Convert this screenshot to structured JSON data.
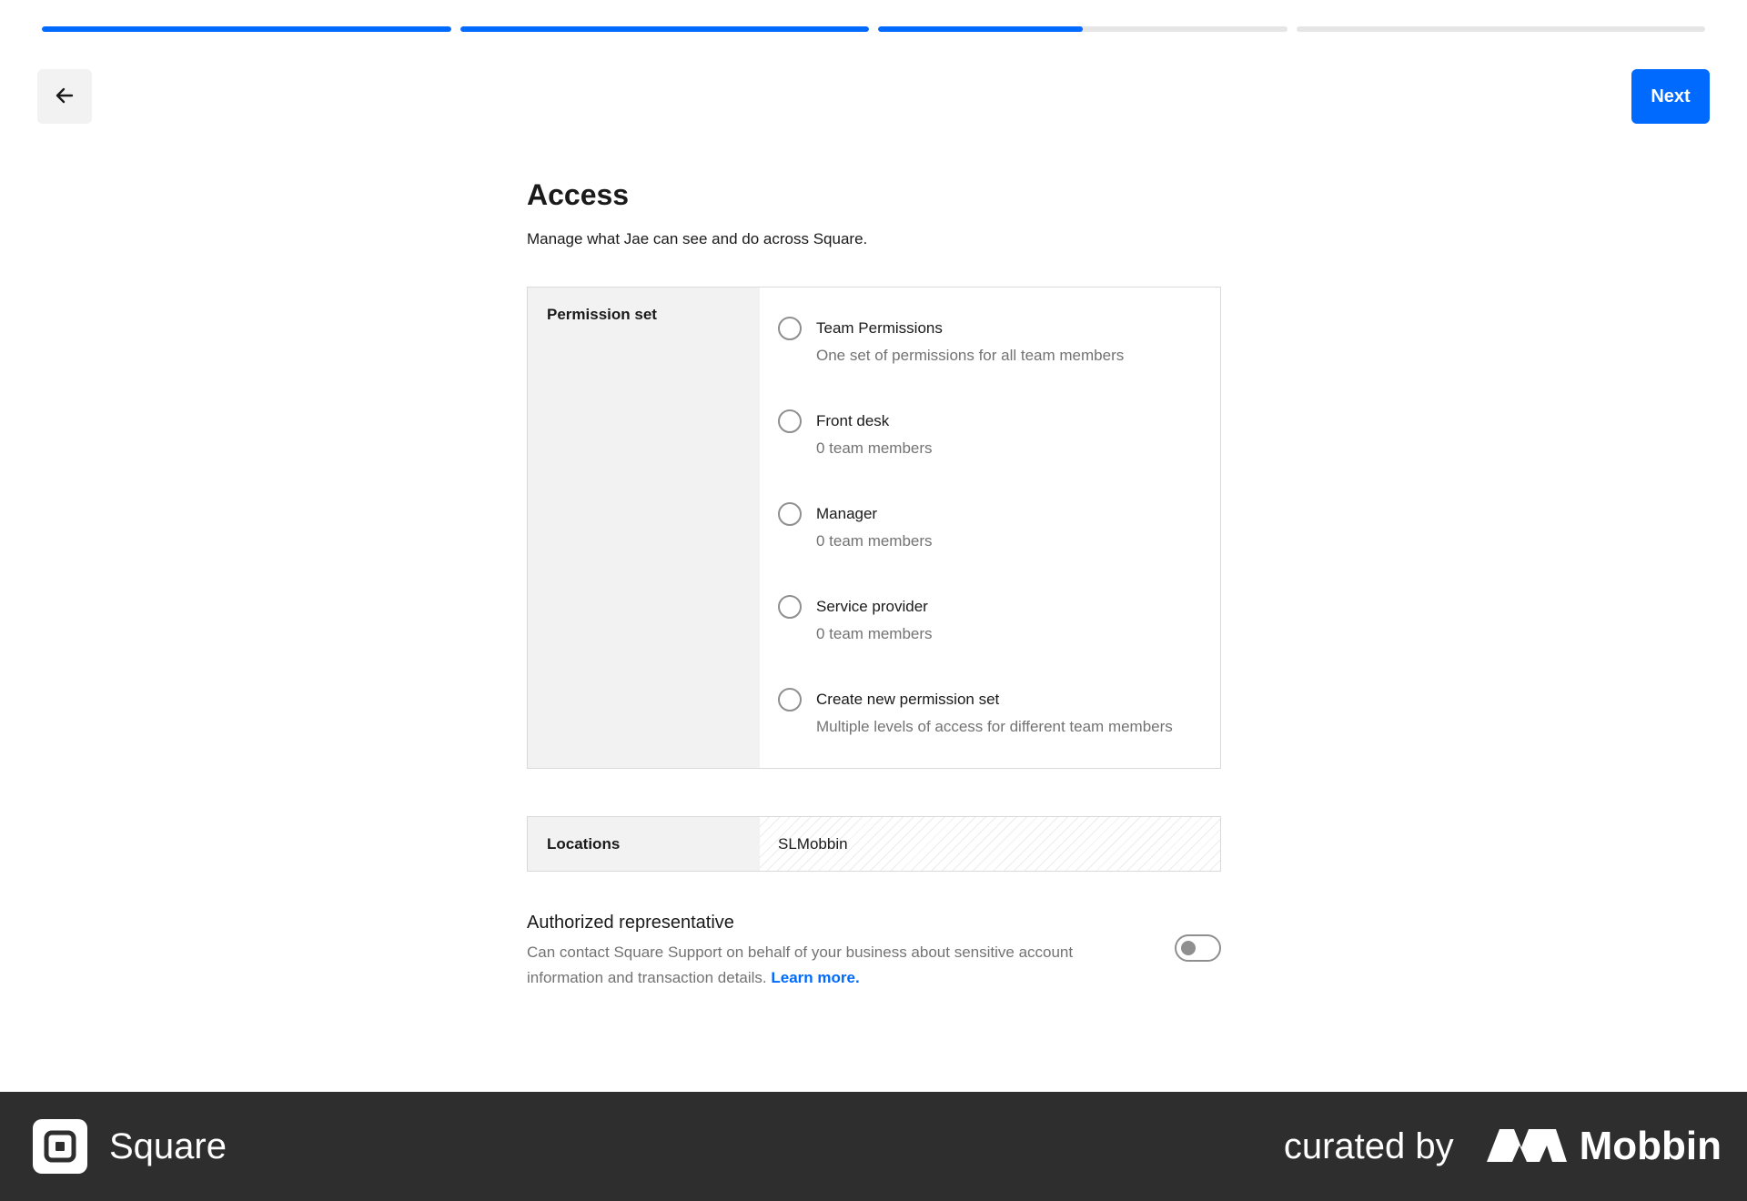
{
  "progress": {
    "segments": [
      {
        "fill": 1.0
      },
      {
        "fill": 1.0
      },
      {
        "fill": 0.5
      },
      {
        "fill": 0.0
      }
    ],
    "accent_color": "#006aff"
  },
  "toolbar": {
    "back_icon": "arrow-left-icon",
    "next_label": "Next"
  },
  "page": {
    "title": "Access",
    "subtitle": "Manage what Jae can see and do across Square."
  },
  "permission_set": {
    "label": "Permission set",
    "options": [
      {
        "title": "Team Permissions",
        "description": "One set of permissions for all team members",
        "selected": false
      },
      {
        "title": "Front desk",
        "description": "0 team members",
        "selected": false
      },
      {
        "title": "Manager",
        "description": "0 team members",
        "selected": false
      },
      {
        "title": "Service provider",
        "description": "0 team members",
        "selected": false
      },
      {
        "title": "Create new permission set",
        "description": "Multiple levels of access for different team members",
        "selected": false
      }
    ]
  },
  "locations": {
    "label": "Locations",
    "value": "SLMobbin"
  },
  "authorized_rep": {
    "title": "Authorized representative",
    "description": "Can contact Square Support on behalf of your business about sensitive account information and transaction details.",
    "link_label": "Learn more.",
    "toggle_on": false
  },
  "footer": {
    "brand_name": "Square",
    "curated_label": "curated by",
    "mobbin_name": "Mobbin"
  }
}
